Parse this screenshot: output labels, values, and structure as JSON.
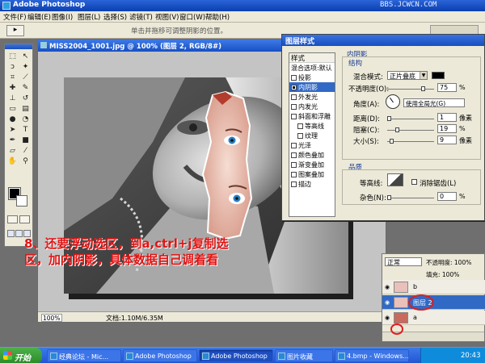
{
  "window": {
    "title": "Adobe Photoshop",
    "watermark": "BBS.JCWCN.COM"
  },
  "menu": [
    "文件(F)",
    "编辑(E)",
    "图像(I)",
    "图层(L)",
    "选择(S)",
    "滤镜(T)",
    "视图(V)",
    "窗口(W)",
    "帮助(H)"
  ],
  "options_bar": {
    "tool_preset": "▸",
    "hint": "单击并拖移可调整阴影的位置。"
  },
  "document": {
    "title": "MISS2004_1001.jpg @ 100% (图层 2, RGB/8#)",
    "zoom": "100%",
    "doc_size": "文档:1.10M/6.35M"
  },
  "annotation": {
    "line1": "8、还要浮动选区，到a,ctrl+j复制选",
    "line2": "区，加内阴影，具体数据自己调着看"
  },
  "layer_style": {
    "title": "图层样式",
    "list_header": "样式",
    "items": [
      {
        "label": "混合选项:默认",
        "checkbox": false,
        "indent": false,
        "active": false
      },
      {
        "label": "投影",
        "checkbox": true,
        "indent": false,
        "active": false
      },
      {
        "label": "内阴影",
        "checkbox": true,
        "indent": false,
        "active": true
      },
      {
        "label": "外发光",
        "checkbox": true,
        "indent": false,
        "active": false
      },
      {
        "label": "内发光",
        "checkbox": true,
        "indent": false,
        "active": false
      },
      {
        "label": "斜面和浮雕",
        "checkbox": true,
        "indent": false,
        "active": false
      },
      {
        "label": "等高线",
        "checkbox": true,
        "indent": true,
        "active": false
      },
      {
        "label": "纹理",
        "checkbox": true,
        "indent": true,
        "active": false
      },
      {
        "label": "光泽",
        "checkbox": true,
        "indent": false,
        "active": false
      },
      {
        "label": "颜色叠加",
        "checkbox": true,
        "indent": false,
        "active": false
      },
      {
        "label": "渐变叠加",
        "checkbox": true,
        "indent": false,
        "active": false
      },
      {
        "label": "图案叠加",
        "checkbox": true,
        "indent": false,
        "active": false
      },
      {
        "label": "描边",
        "checkbox": true,
        "indent": false,
        "active": false
      }
    ],
    "inner_shadow": {
      "section_title": "内阴影",
      "structure_title": "结构",
      "blend_mode_label": "混合模式:",
      "blend_mode": "正片叠底",
      "shadow_color": "#000000",
      "opacity_label": "不透明度(O):",
      "opacity": "75",
      "angle_label": "角度(A):",
      "angle_hint": "使用全局光(G)",
      "distance_label": "距离(D):",
      "distance": "1",
      "choke_label": "阻塞(C):",
      "choke": "19",
      "size_label": "大小(S):",
      "size": "9",
      "percent": "%",
      "pixels": "像素",
      "quality_title": "品质",
      "contour_label": "等高线:",
      "antialias_label": "消除锯齿(L)",
      "noise_label": "杂色(N):",
      "noise": "0"
    }
  },
  "layers": {
    "blend_mode": "正常",
    "opacity_label": "不透明度: 100%",
    "fill_label": "填充: 100%",
    "rows": [
      {
        "name": "b",
        "selected": false
      },
      {
        "name": "图层 2",
        "selected": true
      },
      {
        "name": "a",
        "selected": false
      }
    ]
  },
  "taskbar": {
    "start": "开始",
    "buttons": [
      "经典论坛 - Mic...",
      "Adobe Photoshop",
      "Adobe Photoshop",
      "图片收藏",
      "4.bmp - Windows..."
    ],
    "clock": "20:43"
  },
  "colors": {
    "title_blue": "#0a3fb0",
    "selection": "#316ac5",
    "annotation_red": "#e11414"
  }
}
